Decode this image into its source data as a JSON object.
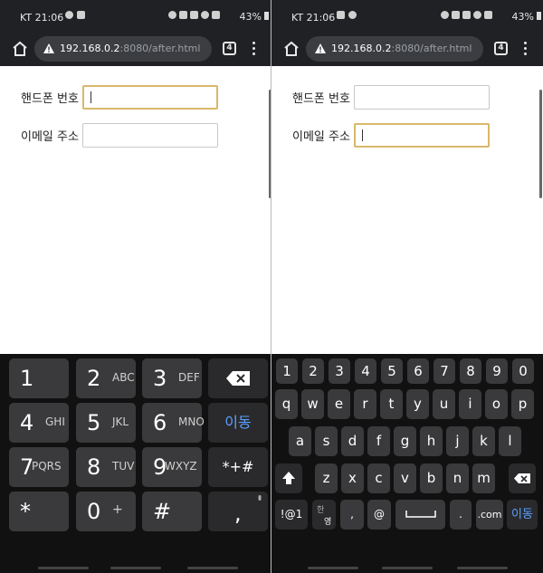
{
  "status": {
    "carrier": "KT",
    "time": "21:06",
    "battery": "43%"
  },
  "browser": {
    "url_host": "192.168.0.2",
    "url_path": ":8080/after.html",
    "tab_count": "4"
  },
  "form": {
    "phone_label": "핸드폰 번호",
    "email_label": "이메일 주소"
  },
  "keypad_numeric": {
    "keys": [
      {
        "main": "1",
        "sub": ""
      },
      {
        "main": "2",
        "sub": "ABC"
      },
      {
        "main": "3",
        "sub": "DEF"
      },
      {
        "main": "4",
        "sub": "GHI"
      },
      {
        "main": "5",
        "sub": "JKL"
      },
      {
        "main": "6",
        "sub": "MNO"
      },
      {
        "main": "7",
        "sub": "PQRS"
      },
      {
        "main": "8",
        "sub": "TUV"
      },
      {
        "main": "9",
        "sub": "WXYZ"
      },
      {
        "main": "*",
        "sub": ""
      },
      {
        "main": "0",
        "sub": "+"
      },
      {
        "main": "#",
        "sub": ""
      }
    ],
    "symbols_label": "*+#",
    "go_label": "이동",
    "comma_label": ","
  },
  "keyboard_qwerty": {
    "numbers": [
      "1",
      "2",
      "3",
      "4",
      "5",
      "6",
      "7",
      "8",
      "9",
      "0"
    ],
    "row1": [
      "q",
      "w",
      "e",
      "r",
      "t",
      "y",
      "u",
      "i",
      "o",
      "p"
    ],
    "row2": [
      "a",
      "s",
      "d",
      "f",
      "g",
      "h",
      "j",
      "k",
      "l"
    ],
    "row3": [
      "z",
      "x",
      "c",
      "v",
      "b",
      "n",
      "m"
    ],
    "sym_label": "!@1",
    "lang_top": "한",
    "lang_bottom": "영",
    "comma": ",",
    "at": "@",
    "period": ".",
    "com": ".com",
    "go_label": "이동"
  }
}
